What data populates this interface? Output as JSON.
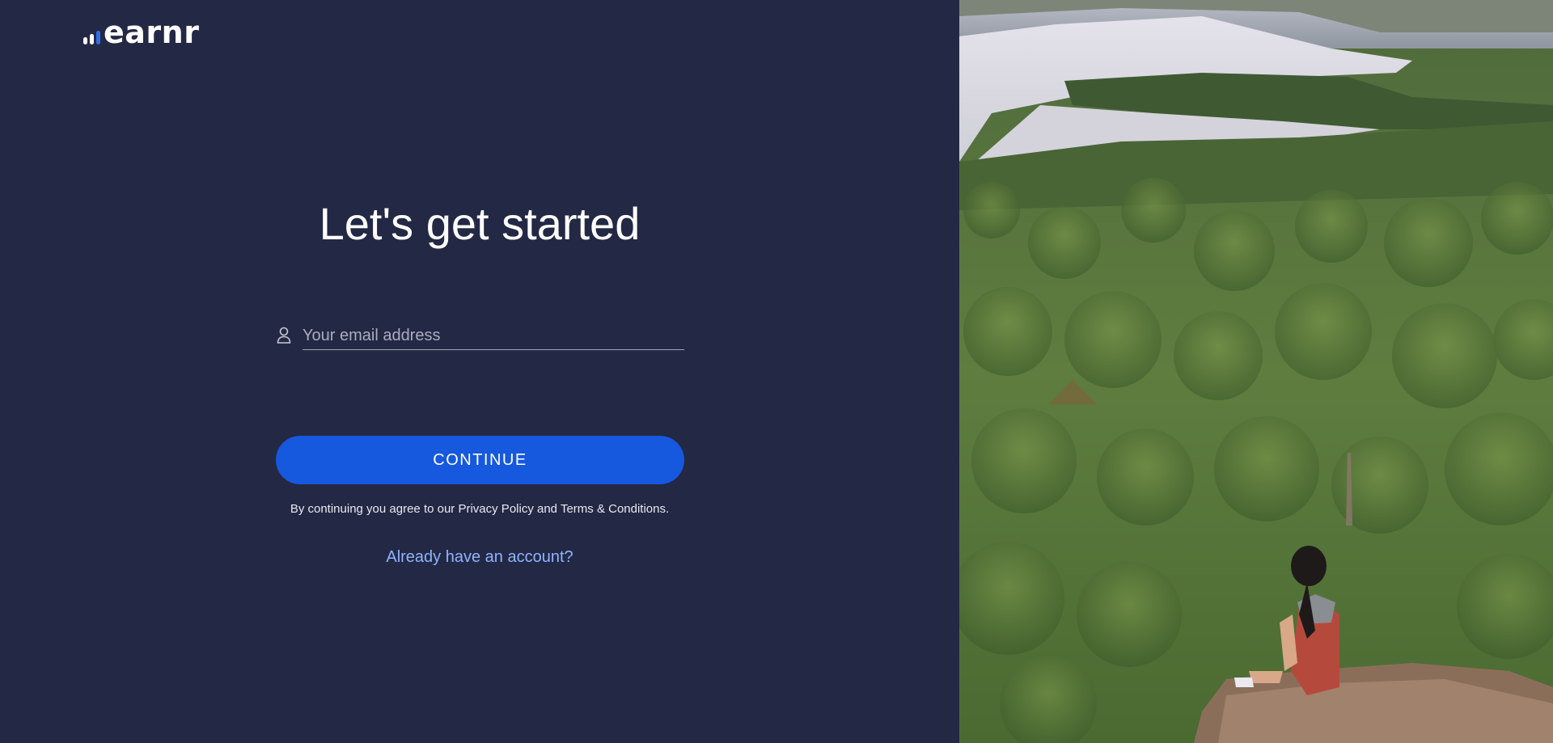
{
  "brand": {
    "name": "earnr",
    "accent_color": "#1658de"
  },
  "signup": {
    "heading": "Let's get started",
    "email_placeholder": "Your email address",
    "continue_label": "CONTINUE",
    "terms_prefix": "By continuing you agree to our",
    "privacy_label": "Privacy Policy",
    "terms_and": "and",
    "terms_label": "Terms & Conditions",
    "terms_suffix": ".",
    "login_link": "Already have an account?"
  },
  "icons": {
    "email_field_icon": "user-icon"
  },
  "colors": {
    "left_panel_bg": "#232844",
    "button_bg": "#1658de",
    "link_color": "#8eb4ff"
  }
}
